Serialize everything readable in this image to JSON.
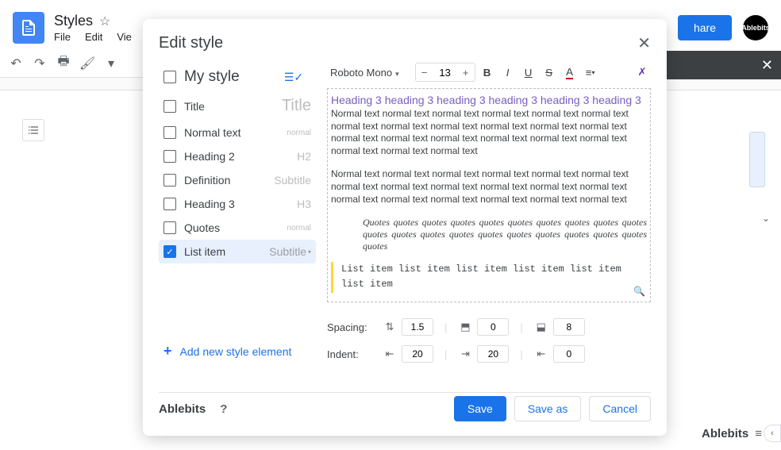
{
  "document": {
    "title": "Styles",
    "menus": [
      "File",
      "Edit",
      "Vie"
    ]
  },
  "share_label": "hare",
  "avatar_label": "Ablebits",
  "modal": {
    "title": "Edit style",
    "styles": [
      {
        "name": "My style",
        "tag": "",
        "big": true
      },
      {
        "name": "Title",
        "tag": "Title",
        "tag_big": true
      },
      {
        "name": "Normal text",
        "tag": "normal",
        "tag_small": true
      },
      {
        "name": "Heading 2",
        "tag": "H2"
      },
      {
        "name": "Definition",
        "tag": "Subtitle"
      },
      {
        "name": "Heading 3",
        "tag": "H3"
      },
      {
        "name": "Quotes",
        "tag": "normal",
        "tag_small": true
      },
      {
        "name": "List item",
        "tag": "Subtitle",
        "checked": true,
        "dd": true
      }
    ],
    "add_label": "Add new style element",
    "font": "Roboto Mono",
    "font_size": "13",
    "preview": {
      "heading3": "Heading 3 heading 3 heading 3 heading 3 heading 3 heading 3",
      "normal1": "Normal text normal text normal text normal text normal text normal text normal text normal text normal text normal text normal text normal text normal text normal text normal text normal text normal text normal text normal text normal text normal text",
      "normal2": "Normal text normal text normal text normal text normal text normal text normal text normal text normal text normal text normal text normal text normal text normal text normal text normal text normal text normal text",
      "quotes": "Quotes quotes quotes quotes quotes quotes quotes quotes quotes quotes quotes quotes quotes quotes quotes quotes quotes quotes quotes quotes quotes",
      "listitem": "List item list item list item list item list item list item"
    },
    "spacing": {
      "label": "Spacing:",
      "v1": "1.5",
      "v2": "0",
      "v3": "8"
    },
    "indent": {
      "label": "Indent:",
      "v1": "20",
      "v2": "20",
      "v3": "0"
    },
    "brand": "Ablebits",
    "help": "?",
    "save": "Save",
    "save_as": "Save as",
    "cancel": "Cancel"
  },
  "bottom_brand": "Ablebits"
}
